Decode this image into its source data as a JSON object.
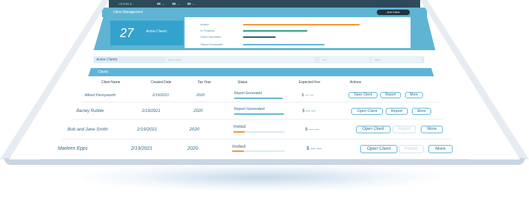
{
  "app": {
    "logo": "LEGIBLE",
    "nav": [
      "—",
      "—",
      "—"
    ]
  },
  "page": {
    "title": "Client Management",
    "add_button": "Add Client"
  },
  "summary": {
    "count": "27",
    "count_label": "Active Clients"
  },
  "stats": [
    {
      "label": "Invited",
      "fill": 1.0,
      "color": "#f0932f"
    },
    {
      "label": "In Progress",
      "fill": 0.55,
      "color": "#2a9a86"
    },
    {
      "label": "Client Submitted",
      "fill": 0.28,
      "color": "#1e5a6a"
    },
    {
      "label": "Report Generated",
      "fill": 0.7,
      "color": "#5fb4d4"
    }
  ],
  "filters": {
    "label": "Active Clients",
    "search_placeholder": "Search Clients",
    "year_placeholder": "Year",
    "status_placeholder": "Status"
  },
  "clients": {
    "title": "Clients",
    "columns": [
      "Client Name",
      "Created Date",
      "Tax Year",
      "Status",
      "Expected Fee",
      "Actions"
    ],
    "rows": [
      {
        "name": "Alfred Pennyworth",
        "created": "2/19/2021",
        "tax_year": "2020",
        "status": "Report Generated",
        "progress": 1.0,
        "status_color": "#5fb4d4",
        "fee": "$ — —",
        "actions": {
          "open": "Open Client",
          "report": "Report",
          "more": "More"
        },
        "report_enabled": true
      },
      {
        "name": "Barney Rubble",
        "created": "2/19/2021",
        "tax_year": "2020",
        "status": "Report Generated",
        "progress": 1.0,
        "status_color": "#5fb4d4",
        "fee": "$ — —",
        "actions": {
          "open": "Open Client",
          "report": "Report",
          "more": "More"
        },
        "report_enabled": true
      },
      {
        "name": "Bob and Jane Smith",
        "created": "2/19/2021",
        "tax_year": "2020",
        "status": "Invited",
        "progress": 0.22,
        "status_color": "#f0932f",
        "fee": "$ — —",
        "actions": {
          "open": "Open Client",
          "report": "Report",
          "more": "More"
        },
        "report_enabled": false
      },
      {
        "name": "Marleen Epps",
        "created": "2/19/2021",
        "tax_year": "2020",
        "status": "Invited",
        "progress": 0.22,
        "status_color": "#f0932f",
        "fee": "$ — —",
        "actions": {
          "open": "Open Client",
          "report": "Report",
          "more": "More"
        },
        "report_enabled": false
      }
    ]
  }
}
